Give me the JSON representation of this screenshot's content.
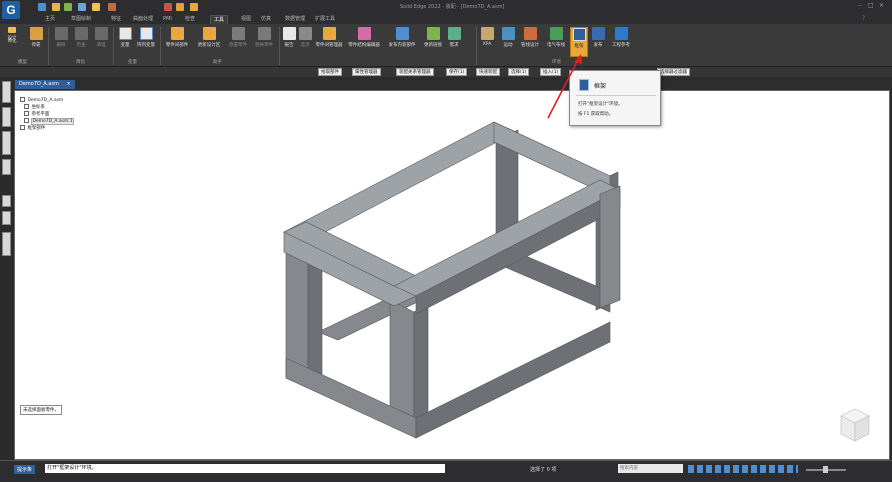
{
  "app": {
    "logo_glyph": "G",
    "window_title": "Solid Edge 2022 - 装配 - [Demo7D_A.asm]"
  },
  "tabs": [
    "主页",
    "草图绘制",
    "特征",
    "曲面处理",
    "PMI",
    "检查",
    "工具",
    "视图",
    "仿真",
    "数据管理",
    "扩展工具"
  ],
  "active_tab": "工具",
  "ribbon": {
    "groups": [
      {
        "label": "模型",
        "buttons": [
          "设计",
          "简化",
          "停靠"
        ]
      },
      {
        "label": "简化",
        "buttons": [
          "删除",
          "检查",
          "清理"
        ]
      },
      {
        "label": "变量",
        "buttons": [
          "变量",
          "阵列变量"
        ]
      },
      {
        "label": "助手",
        "buttons": [
          "零件间部件",
          "更新设计区",
          "放置零件",
          "替换零件"
        ]
      },
      {
        "label": "助手2",
        "buttons": [
          "报告",
          "选项",
          "零件间管理器",
          "零件结构编辑器",
          "发布内容部件",
          "更新链接",
          "需求"
        ]
      },
      {
        "label": "环境",
        "buttons": [
          "XPA",
          "运动",
          "管线设计",
          "电气布线",
          "框架",
          "发布",
          "工程参考"
        ]
      }
    ],
    "highlighted_button": "框架"
  },
  "doc_toolbar": [
    "拾取部件",
    "属性管理器",
    "装配关系管理器",
    "保存(1)",
    "快速装配",
    "选择(1)",
    "插入(1)",
    "选择器过滤器"
  ],
  "document_tab": {
    "label": "Demo7D_A.asm",
    "close": "×"
  },
  "tree": [
    {
      "label": "Demo7D_A.asm",
      "indent": 0
    },
    {
      "label": "坐标系",
      "indent": 1
    },
    {
      "label": "参考平面",
      "indent": 1
    },
    {
      "label": "Demo7D_A.asm:1",
      "indent": 1
    },
    {
      "label": "框架部件",
      "indent": 0
    }
  ],
  "popup": {
    "title": "框架",
    "line1": "打开\"框架设计\"环境。",
    "line2": "按 F1 获取帮助。"
  },
  "viewport_prompt": "未选择面板零件。",
  "status": {
    "prompt_label": "提示条",
    "message": "打开\"框架设计\"环境。",
    "selection": "选择了 0 项",
    "search_placeholder": "搜索内容"
  },
  "colors": {
    "frame_top": "#9ea3a8",
    "frame_left": "#85898e",
    "frame_right": "#6d7176",
    "accent_blue": "#2f5f96",
    "highlight_orange": "#e8a93a"
  }
}
